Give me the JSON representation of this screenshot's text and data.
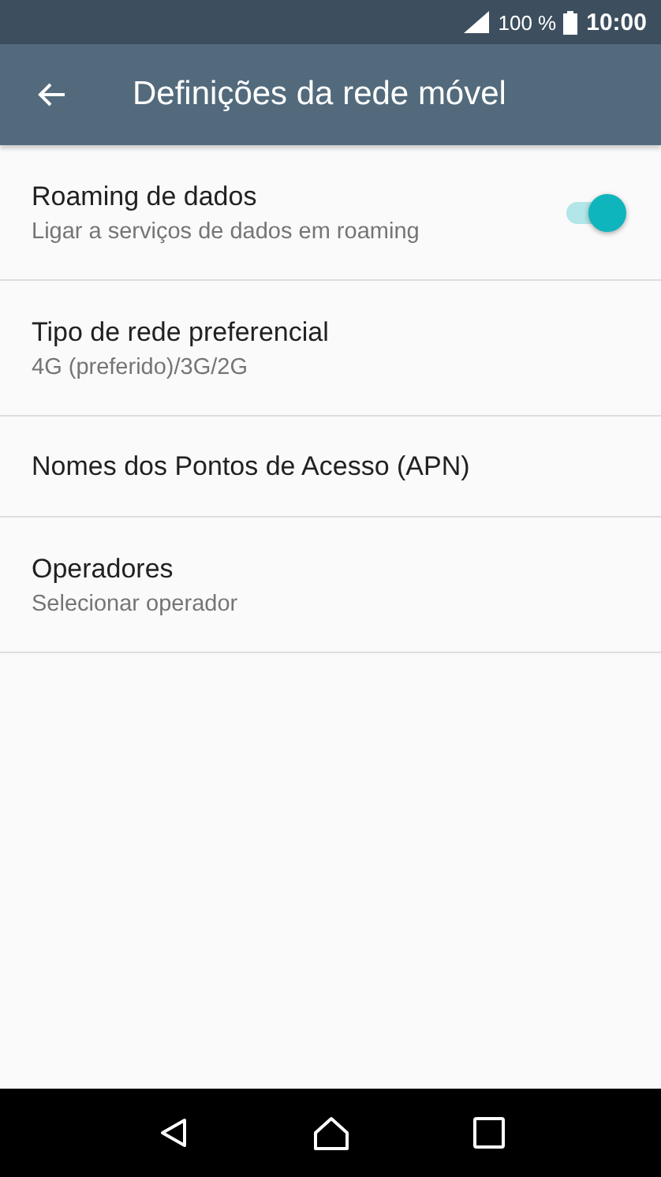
{
  "status_bar": {
    "battery": "100 %",
    "time": "10:00"
  },
  "app_bar": {
    "title": "Definições da rede móvel"
  },
  "settings": [
    {
      "kind": "switch",
      "title": "Roaming de dados",
      "summary": "Ligar a serviços de dados em roaming",
      "on": true
    },
    {
      "kind": "text",
      "title": "Tipo de rede preferencial",
      "summary": "4G (preferido)/3G/2G"
    },
    {
      "kind": "text",
      "title": "Nomes dos Pontos de Acesso (APN)"
    },
    {
      "kind": "text",
      "title": "Operadores",
      "summary": "Selecionar operador"
    }
  ]
}
